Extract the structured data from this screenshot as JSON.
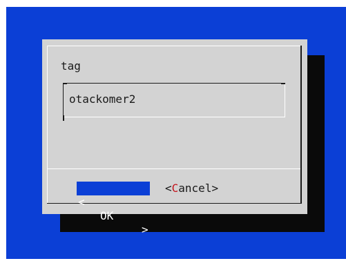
{
  "dialog": {
    "prompt": "tag",
    "input_value": "otackomer2"
  },
  "buttons": {
    "ok": {
      "left": "<",
      "label": "OK",
      "right": ">"
    },
    "cancel": {
      "left": "<",
      "hotkey": "C",
      "rest": "ancel",
      "right": ">"
    }
  },
  "colors": {
    "background": "#0b3fd6",
    "dialog": "#d3d3d3",
    "shadow": "#0a0a0a",
    "selected_button": "#0b3fd6",
    "hotkey": "#c4141c"
  }
}
